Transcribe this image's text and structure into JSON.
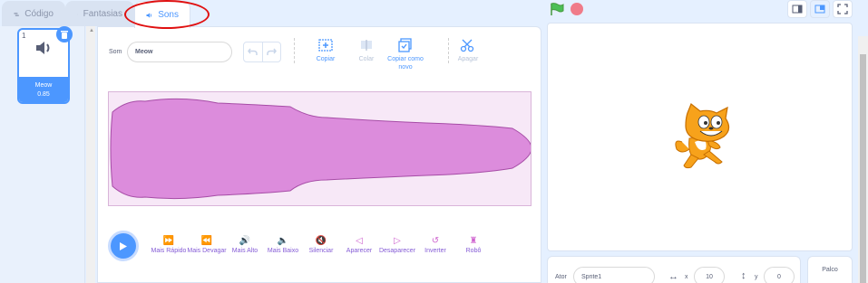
{
  "tabs": [
    {
      "label": "Código"
    },
    {
      "label": "Fantasias"
    },
    {
      "label": "Sons"
    }
  ],
  "sound_list": {
    "items": [
      {
        "number": "1",
        "name": "Meow",
        "duration": "0.85"
      }
    ]
  },
  "editor": {
    "sound_label": "Som",
    "sound_name_value": "Meow",
    "tools": {
      "copy": "Copiar",
      "paste": "Colar",
      "copy_new": "Copiar como novo",
      "delete": "Apagar"
    },
    "effects": [
      {
        "label": "Mais Rápido",
        "icon": "fast-forward-icon"
      },
      {
        "label": "Mais Devagar",
        "icon": "rewind-icon"
      },
      {
        "label": "Mais Alto",
        "icon": "louder-icon"
      },
      {
        "label": "Mais Baixo",
        "icon": "softer-icon"
      },
      {
        "label": "Silenciar",
        "icon": "mute-icon"
      },
      {
        "label": "Aparecer",
        "icon": "fade-in-icon"
      },
      {
        "label": "Desaparecer",
        "icon": "fade-out-icon"
      },
      {
        "label": "Inverter",
        "icon": "reverse-icon"
      },
      {
        "label": "Robô",
        "icon": "robot-icon"
      }
    ]
  },
  "sprite_info": {
    "actor_label": "Ator",
    "actor_name": "Sprite1",
    "x_label": "x",
    "x_value": "10",
    "y_label": "y",
    "y_value": "0",
    "stage_label": "Palco"
  },
  "colors": {
    "accent": "#4c97ff",
    "sound_purple": "#cf63cf",
    "wave_fill": "#dc8cdc",
    "annotation_red": "#e01010"
  }
}
